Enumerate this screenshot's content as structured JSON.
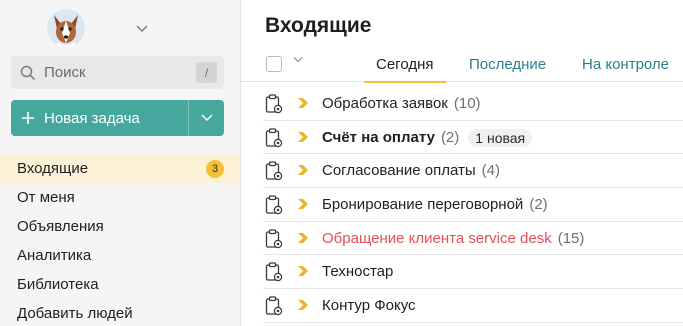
{
  "sidebar": {
    "account_icon": "dog-avatar-icon",
    "search": {
      "placeholder": "Поиск",
      "hotkey": "/"
    },
    "new_task": {
      "label": "Новая задача"
    },
    "nav": [
      {
        "label": "Входящие",
        "badge": "3",
        "active": true
      },
      {
        "label": "От меня"
      },
      {
        "label": "Объявления"
      },
      {
        "label": "Аналитика"
      },
      {
        "label": "Библиотека"
      },
      {
        "label": "Добавить людей"
      }
    ]
  },
  "main": {
    "title": "Входящие",
    "tabs": [
      {
        "label": "Сегодня",
        "active": true
      },
      {
        "label": "Последние"
      },
      {
        "label": "На контроле"
      }
    ],
    "rows": [
      {
        "title": "Обработка заявок",
        "count": "(10)"
      },
      {
        "title": "Счёт на оплату",
        "count": "(2)",
        "new_badge": "1 новая",
        "bold": true
      },
      {
        "title": "Согласование оплаты",
        "count": "(4)"
      },
      {
        "title": "Бронирование переговорной",
        "count": "(2)"
      },
      {
        "title": "Обращение клиента service desk",
        "count": "(15)",
        "highlight": "red"
      },
      {
        "title": "Техностар"
      },
      {
        "title": "Контур Фокус"
      }
    ]
  },
  "colors": {
    "accent_teal": "#45a79d",
    "tab_link": "#2b7f8e",
    "badge_yellow": "#f3c234",
    "active_nav_bg": "#fcf1d6",
    "arrow_yellow": "#e9b82a",
    "alert_red": "#e5505c"
  }
}
